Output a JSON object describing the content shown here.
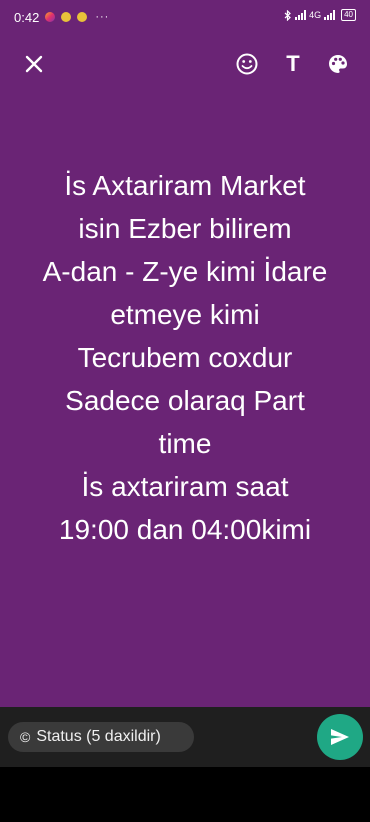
{
  "status_bar": {
    "time": "0:42",
    "more": "···",
    "network": "4G",
    "battery": "40"
  },
  "toolbar": {
    "close_icon": "close-icon",
    "emoji_icon": "emoji-icon",
    "text_label": "T",
    "palette_icon": "palette-icon"
  },
  "message": {
    "lines": [
      "İs Axtariram Market",
      "isin Ezber bilirem",
      "A-dan - Z-ye kimi İdare",
      "etmeye kimi",
      "Tecrubem coxdur",
      "Sadece olaraq Part",
      "time",
      "İs axtariram saat",
      "19:00 dan 04:00kimi"
    ]
  },
  "bottom": {
    "audience_icon": "©",
    "audience_label": "Status (5 daxildir)",
    "send_icon": "send-icon"
  },
  "colors": {
    "background": "#6a2475",
    "send_button": "#1fa885",
    "bottom_bar": "#1f1f1f"
  }
}
